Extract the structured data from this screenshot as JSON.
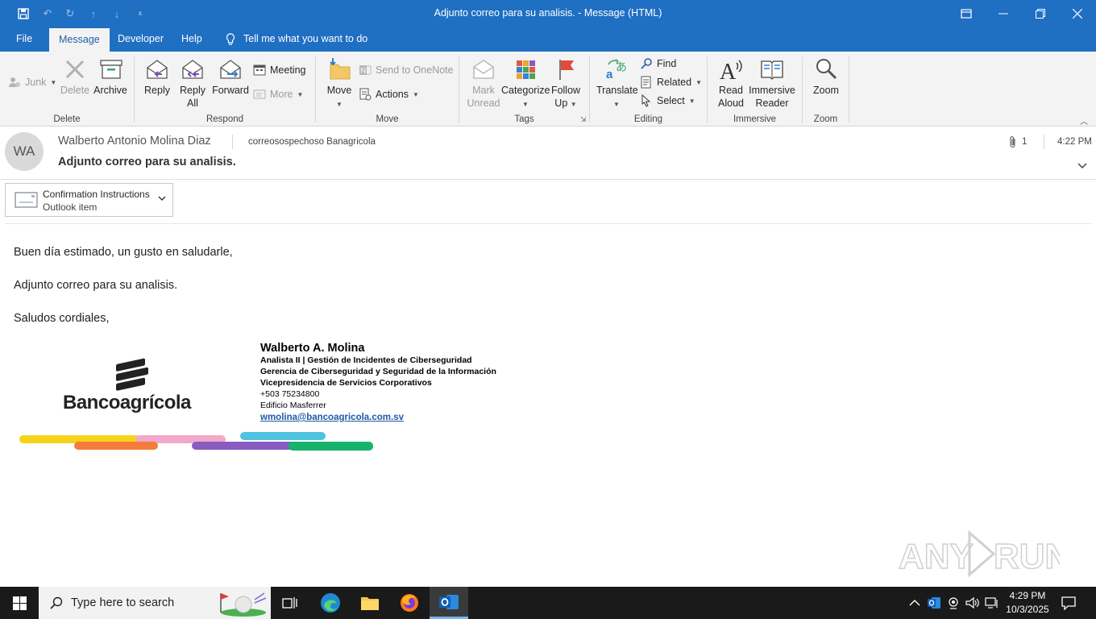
{
  "window": {
    "title": "Adjunto correo para su analisis.  -  Message (HTML)"
  },
  "tabs": [
    {
      "label": "File"
    },
    {
      "label": "Message"
    },
    {
      "label": "Developer"
    },
    {
      "label": "Help"
    },
    {
      "label": "Tell me what you want to do"
    }
  ],
  "ribbon": {
    "delete_group": {
      "label": "Delete",
      "junk": "Junk",
      "delete": "Delete",
      "archive": "Archive"
    },
    "respond_group": {
      "label": "Respond",
      "reply": "Reply",
      "reply_all_1": "Reply",
      "reply_all_2": "All",
      "forward": "Forward",
      "meeting": "Meeting",
      "more": "More"
    },
    "move_group": {
      "label": "Move",
      "move": "Move",
      "onenote": "Send to OneNote",
      "actions": "Actions"
    },
    "tags_group": {
      "label": "Tags",
      "mark_1": "Mark",
      "mark_2": "Unread",
      "categorize": "Categorize",
      "follow_1": "Follow",
      "follow_2": "Up"
    },
    "editing_group": {
      "label": "Editing",
      "translate": "Translate",
      "find": "Find",
      "related": "Related",
      "select": "Select"
    },
    "immersive_group": {
      "label": "Immersive",
      "read_1": "Read",
      "read_2": "Aloud",
      "imm_1": "Immersive",
      "imm_2": "Reader"
    },
    "zoom_group": {
      "label": "Zoom",
      "zoom": "Zoom"
    }
  },
  "message": {
    "avatar_initials": "WA",
    "sender": "Walberto Antonio Molina Diaz",
    "recipient": "correosospechoso Banagricola",
    "subject": "Adjunto correo para su analisis.",
    "attachment_count": "1",
    "time": "4:22 PM",
    "attachment": {
      "name": "Confirmation Instructions",
      "type": "Outlook item"
    },
    "body": [
      "Buen día estimado, un gusto en saludarle,",
      "Adjunto correo para su analisis.",
      "Saludos cordiales,"
    ],
    "logo_text": "Bancoagrícola",
    "signature": {
      "name": "Walberto A. Molina",
      "line1": "Analista II | Gestión de Incidentes de Ciberseguridad",
      "line2": "Gerencia de Ciberseguridad y Seguridad de la Información",
      "line3": "Vicepresidencia de Servicios Corporativos",
      "phone": "+503 75234800",
      "building": "Edificio Masferrer",
      "email": "wmolina@bancoagricola.com.sv"
    }
  },
  "watermark": "ANY RUN",
  "taskbar": {
    "search_placeholder": "Type here to search",
    "time": "4:29 PM",
    "date": "10/3/2025"
  },
  "colors": {
    "accent": "#1f6fc3",
    "link": "#1f5aa6"
  }
}
